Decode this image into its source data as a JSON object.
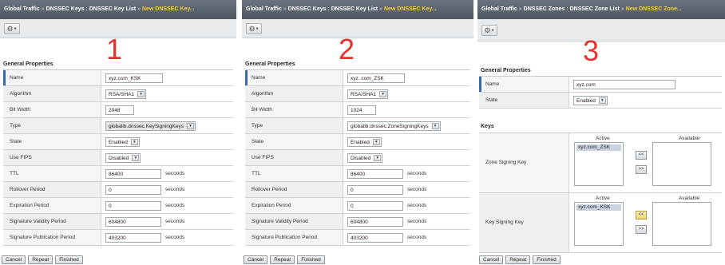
{
  "panels": [
    {
      "breadcrumb": [
        "Global Traffic",
        "DNSSEC Keys : DNSSEC Key List",
        "New DNSSEC Key..."
      ],
      "step_number": "1",
      "section_title": "General Properties",
      "fields": [
        {
          "label": "Name",
          "kind": "text",
          "value": "xyz.com_KSK"
        },
        {
          "label": "Algorithm",
          "kind": "select",
          "value": "RSA/SHA1"
        },
        {
          "label": "Bit Width",
          "kind": "text",
          "value": "2048"
        },
        {
          "label": "Type",
          "kind": "select",
          "value": "globallb.dnssec.KeySigningKeys"
        },
        {
          "label": "State",
          "kind": "select",
          "value": "Enabled"
        },
        {
          "label": "Use FIPS",
          "kind": "select",
          "value": "Disabled"
        },
        {
          "label": "TTL",
          "kind": "text",
          "value": "86400",
          "unit": "seconds"
        },
        {
          "label": "Rollover Period",
          "kind": "text",
          "value": "0",
          "unit": "seconds"
        },
        {
          "label": "Expiration Period",
          "kind": "text",
          "value": "0",
          "unit": "seconds"
        },
        {
          "label": "Signature Validity Period",
          "kind": "text",
          "value": "604800",
          "unit": "seconds"
        },
        {
          "label": "Signature Publication Period",
          "kind": "text",
          "value": "403200",
          "unit": "seconds"
        }
      ]
    },
    {
      "breadcrumb": [
        "Global Traffic",
        "DNSSEC Keys : DNSSEC Key List",
        "New DNSSEC Key..."
      ],
      "step_number": "2",
      "section_title": "General Properties",
      "fields": [
        {
          "label": "Name",
          "kind": "text",
          "value": "xyz. com_ZSK"
        },
        {
          "label": "Algorithm",
          "kind": "select",
          "value": "RSA/SHA1"
        },
        {
          "label": "Bit Width",
          "kind": "text",
          "value": "1024"
        },
        {
          "label": "Type",
          "kind": "select",
          "value": "globallb.dnssec.ZoneSigningKeys"
        },
        {
          "label": "State",
          "kind": "select",
          "value": "Enabled"
        },
        {
          "label": "Use FIPS",
          "kind": "select",
          "value": "Disabled"
        },
        {
          "label": "TTL",
          "kind": "text",
          "value": "86400",
          "unit": "seconds"
        },
        {
          "label": "Rollover Period",
          "kind": "text",
          "value": "0",
          "unit": "seconds"
        },
        {
          "label": "Expiration Period",
          "kind": "text",
          "value": "0",
          "unit": "seconds"
        },
        {
          "label": "Signature Validity Period",
          "kind": "text",
          "value": "604800",
          "unit": "seconds"
        },
        {
          "label": "Signature Publication Period",
          "kind": "text",
          "value": "403200",
          "unit": "seconds"
        }
      ]
    },
    {
      "breadcrumb": [
        "Global Traffic",
        "DNSSEC Zones : DNSSEC Zone List",
        "New DNSSEC Zone..."
      ],
      "step_number": "3",
      "section_title": "General Properties",
      "fields": [
        {
          "label": "Name",
          "kind": "text",
          "value": "xyz.com"
        },
        {
          "label": "State",
          "kind": "select",
          "value": "Enabled"
        }
      ],
      "keys_title": "Keys",
      "keys": [
        {
          "label": "Zone Signing Key",
          "active_header": "Active",
          "available_header": "Available",
          "active_items": [
            "xyz.com_ZSK"
          ],
          "available_items": [],
          "move_left": "<<",
          "move_right": ">>"
        },
        {
          "label": "Key Signing Key",
          "active_header": "Active",
          "available_header": "Available",
          "active_items": [
            "xyz.com_KSK"
          ],
          "available_items": [],
          "move_left": "<<",
          "move_right": ">>"
        }
      ]
    }
  ],
  "buttons": {
    "cancel": "Cancel",
    "repeat": "Repeat",
    "finished": "Finished"
  },
  "icons": {
    "toolbar_menu": "gear-icon",
    "dropdown_arrow": "chevron-down-icon"
  },
  "colors": {
    "step_number": "#e8322c",
    "breadcrumb_current": "#f2cc3a",
    "titlebar": "#5a636e"
  }
}
